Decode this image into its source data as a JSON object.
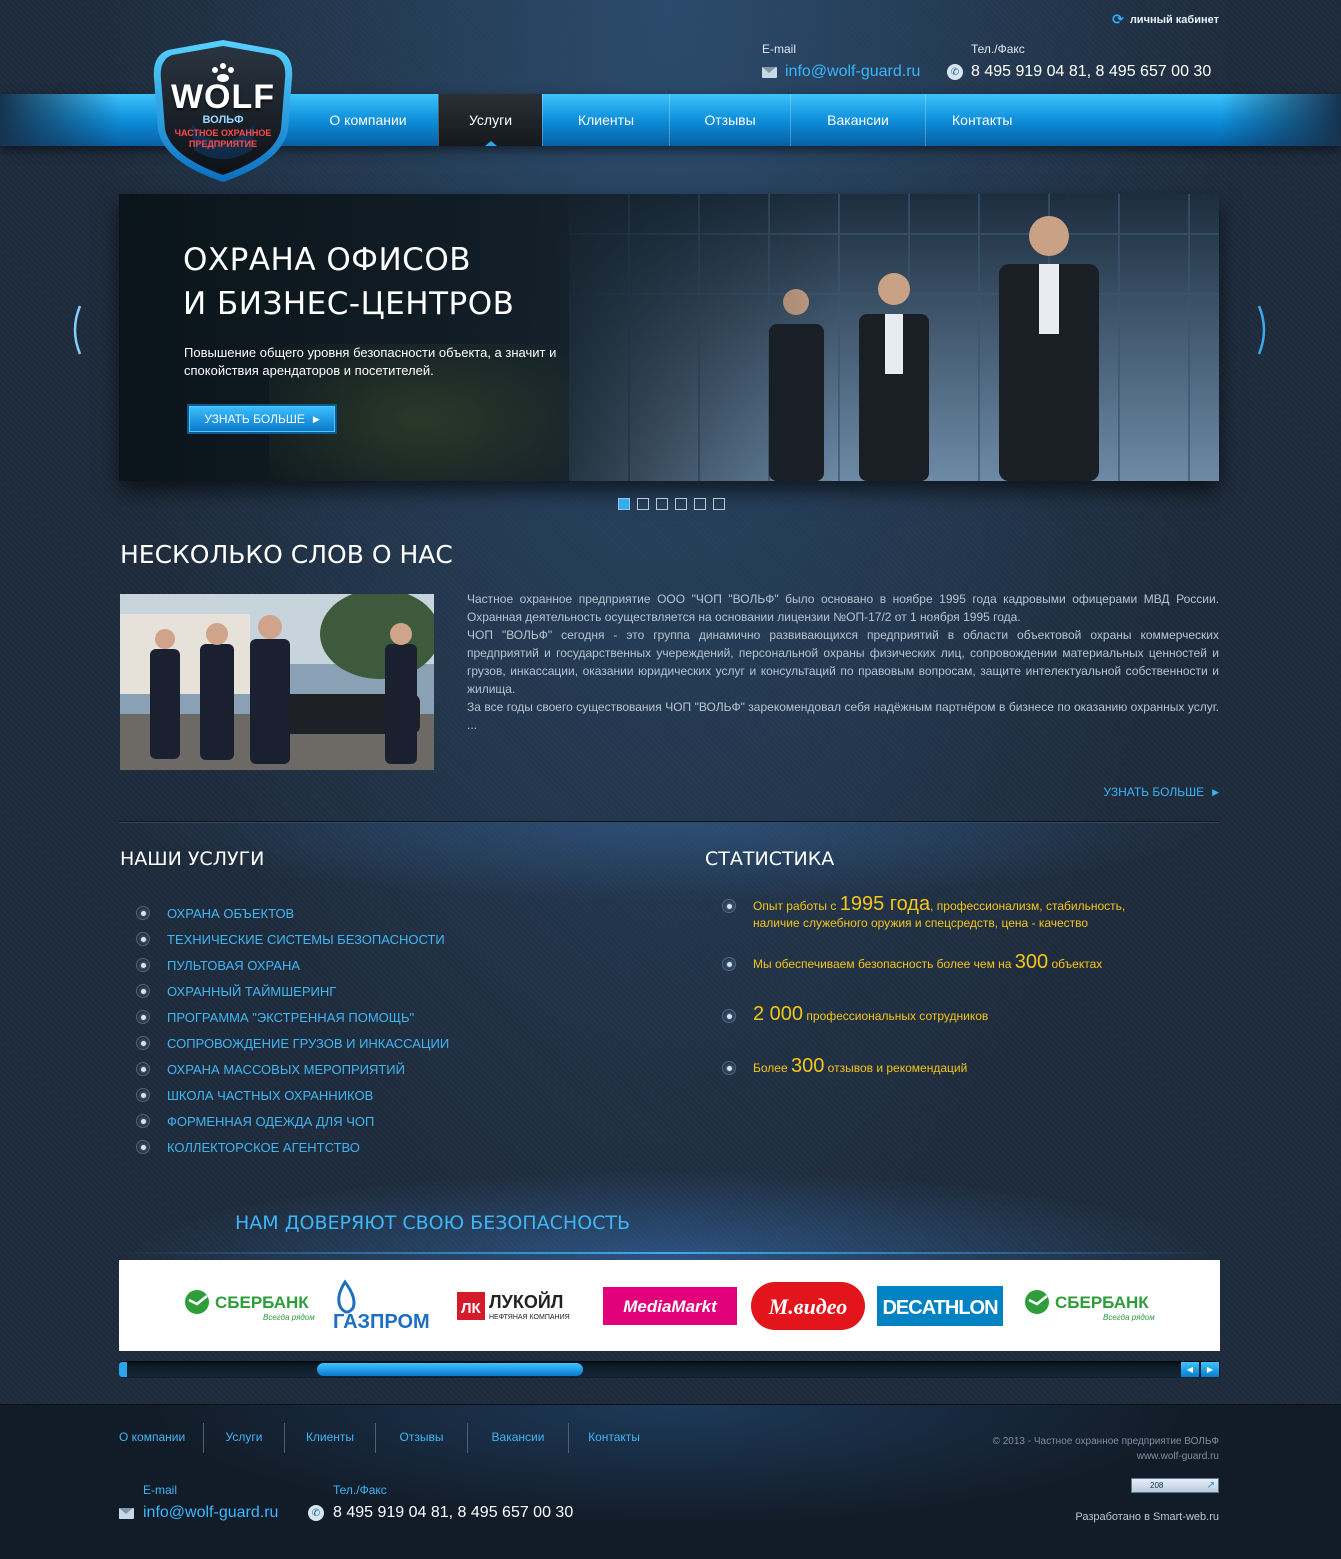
{
  "header": {
    "cabinet_label": "личный кабинет",
    "email_label": "E-mail",
    "email": "info@wolf-guard.ru",
    "phone_label": "Тел./Факс",
    "phones": "8 495 919 04 81,  8 495 657 00 30"
  },
  "logo": {
    "brand": "WOLF",
    "brand_ru": "ВОЛЬФ",
    "tagline_1": "ЧАСТНОЕ ОХРАННОЕ",
    "tagline_2": "ПРЕДПРИЯТИЕ"
  },
  "nav": {
    "items": [
      {
        "label": "О компании"
      },
      {
        "label": "Услуги"
      },
      {
        "label": "Клиенты"
      },
      {
        "label": "Отзывы"
      },
      {
        "label": "Вакансии"
      },
      {
        "label": "Контакты"
      }
    ],
    "active": "Услуги"
  },
  "slider": {
    "title_line1": "ОХРАНА ОФИСОВ",
    "title_line2": "И БИЗНЕС-ЦЕНТРОВ",
    "desc": "Повышение общего уровня безопасности объекта, а значит и спокойствия арендаторов и посетителей.",
    "button": "УЗНАТЬ БОЛЬШЕ",
    "slides_total": 6,
    "active_slide": 1
  },
  "about": {
    "title": "НЕСКОЛЬКО СЛОВ О НАС",
    "p1": "Частное охранное предприятие ООО \"ЧОП \"ВОЛЬФ\" было основано в ноябре 1995 года кадровыми офицерами МВД России. Охранная деятельность осуществляется на основании лицензии №ОП-17/2 от 1 ноября 1995 года.",
    "p2": "ЧОП \"ВОЛЬФ\" сегодня - это группа динамично развивающихся предприятий в области объектовой охраны коммерческих предприятий и государственных учереждений, персональной охраны физических лиц, сопровождении материальных ценностей и грузов, инкассации, оказании юридических услуг и консультаций по правовым вопросам, защите интелектуальной собственности и жилища.",
    "p3": "За все годы своего существования ЧОП \"ВОЛЬФ\" зарекомендовал себя надёжным партнёром в бизнесе по оказанию охранных услуг. ...",
    "more": "УЗНАТЬ БОЛЬШЕ"
  },
  "services": {
    "title": "НАШИ УСЛУГИ",
    "items": [
      "ОХРАНА ОБЪЕКТОВ",
      "ТЕХНИЧЕСКИЕ СИСТЕМЫ БЕЗОПАСНОСТИ",
      "ПУЛЬТОВАЯ ОХРАНА",
      "ОХРАННЫЙ ТАЙМШЕРИНГ",
      "ПРОГРАММА \"ЭКСТРЕННАЯ ПОМОЩЬ\"",
      "СОПРОВОЖДЕНИЕ ГРУЗОВ И ИНКАССАЦИИ",
      "ОХРАНА МАССОВЫХ МЕРОПРИЯТИЙ",
      "ШКОЛА ЧАСТНЫХ ОХРАННИКОВ",
      "ФОРМЕННАЯ ОДЕЖДА ДЛЯ ЧОП",
      "КОЛЛЕКТОРСКОЕ АГЕНТСТВО"
    ]
  },
  "stats": {
    "title": "СТАТИСТИКА",
    "s1_pre": "Опыт работы с ",
    "s1_big": "1995 года",
    "s1_post": ", профессионализм, стабильность,",
    "s1_line2": "наличие служебного оружия и спецсредств, цена - качество",
    "s2_pre": "Мы обеспечиваем безопасность более чем на ",
    "s2_big": "300",
    "s2_post": " объектах",
    "s3_big": "2 000",
    "s3_post": " профессиональных сотрудников",
    "s4_pre": "Более ",
    "s4_big": "300",
    "s4_post": " отзывов и рекомендаций"
  },
  "partners": {
    "title": "НАМ ДОВЕРЯЮТ  СВОЮ БЕЗОПАСНОСТЬ",
    "logos": [
      {
        "name": "СБЕРБАНК",
        "sub": "Всегда рядом"
      },
      {
        "name": "ГАЗПРОМ"
      },
      {
        "name": "ЛУКОЙЛ",
        "sub": "НЕФТЯНАЯ КОМПАНИЯ"
      },
      {
        "name": "MediaMarkt"
      },
      {
        "name": "М.видео"
      },
      {
        "name": "DECATHLON"
      },
      {
        "name": "СБЕРБАНК",
        "sub": "Всегда рядом"
      }
    ],
    "scroll_position": 0.24
  },
  "footer": {
    "nav": [
      "О компании",
      "Услуги",
      "Клиенты",
      "Отзывы",
      "Вакансии",
      "Контакты"
    ],
    "copyright": "© 2013 - Частное охранное предприятие ВОЛЬФ",
    "site": "www.wolf-guard.ru",
    "counter": "208",
    "developer": "Разработано в Smart-web.ru",
    "email_label": "E-mail",
    "email": "info@wolf-guard.ru",
    "phone_label": "Тел./Факс",
    "phones": "8 495 919 04 81,  8 495 657 00 30"
  },
  "colors": {
    "accent": "#37b8ff",
    "stats_yellow": "#f5c518",
    "background": "#1e2b3c"
  }
}
